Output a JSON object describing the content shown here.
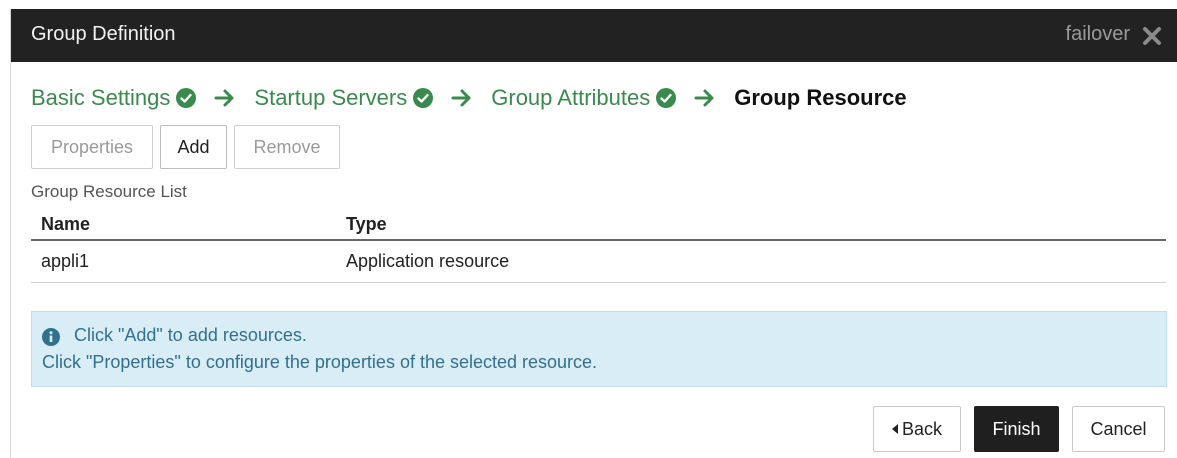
{
  "titlebar": {
    "title": "Group Definition",
    "cluster_name": "failover",
    "close_icon": "close-icon"
  },
  "wizard_steps": [
    {
      "label": "Basic Settings",
      "status": "completed"
    },
    {
      "label": "Startup Servers",
      "status": "completed"
    },
    {
      "label": "Group Attributes",
      "status": "completed"
    },
    {
      "label": "Group Resource",
      "status": "current"
    }
  ],
  "toolbar": {
    "properties_label": "Properties",
    "add_label": "Add",
    "remove_label": "Remove"
  },
  "resource_list": {
    "label": "Group Resource List",
    "columns": [
      "Name",
      "Type"
    ],
    "rows": [
      {
        "name": "appli1",
        "type": "Application resource"
      }
    ]
  },
  "info": {
    "line1": "Click \"Add\" to add resources.",
    "line2": "Click \"Properties\" to configure the properties of the selected resource."
  },
  "footer": {
    "back_label": "Back",
    "finish_label": "Finish",
    "cancel_label": "Cancel"
  },
  "colors": {
    "titlebar_bg": "#222222",
    "completed_step": "#3a8a4e",
    "info_bg": "#d9edf7",
    "info_text": "#31708f",
    "primary_button": "#1f1f1f"
  }
}
